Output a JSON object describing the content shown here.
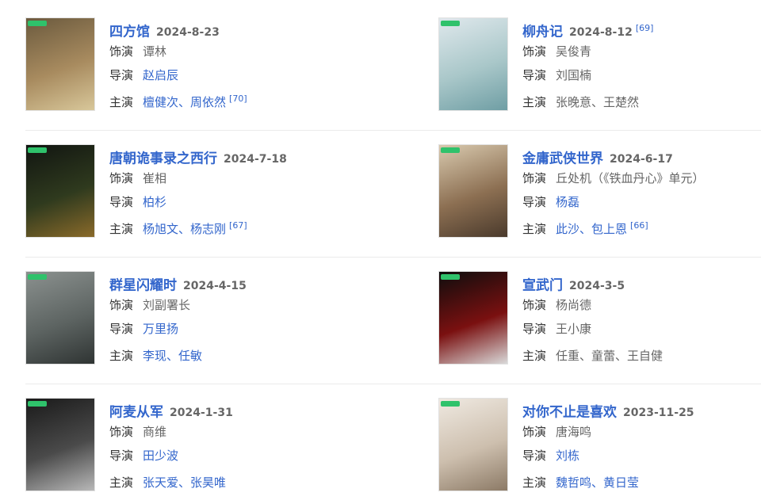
{
  "works": [
    {
      "title": "四方馆",
      "date": "2024-8-23",
      "ref": "",
      "role_label": "饰演",
      "role": "谭林",
      "director_label": "导演",
      "director": "赵启辰",
      "cast_label": "主演",
      "cast": "檀健次、周依然",
      "cast_ref": "[70]",
      "colors": [
        "#6b5a3e",
        "#a88b5f",
        "#d8c79a"
      ]
    },
    {
      "title": "柳舟记",
      "date": "2024-8-12",
      "ref": "[69]",
      "role_label": "饰演",
      "role": "吴俊青",
      "director_label": "导演",
      "director": "刘国楠",
      "cast_label": "主演",
      "cast": "张晚意、王楚然",
      "cast_ref": "",
      "colors": [
        "#dfe8ec",
        "#a9c7c9",
        "#6f9ea4"
      ]
    },
    {
      "title": "唐朝诡事录之西行",
      "date": "2024-7-18",
      "ref": "",
      "role_label": "饰演",
      "role": "崔相",
      "director_label": "导演",
      "director": "柏杉",
      "cast_label": "主演",
      "cast": "杨旭文、杨志刚",
      "cast_ref": "[67]",
      "colors": [
        "#111511",
        "#2f3a1e",
        "#8a6a2a"
      ]
    },
    {
      "title": "金庸武侠世界",
      "date": "2024-6-17",
      "ref": "",
      "role_label": "饰演",
      "role": "丘处机（《铁血丹心》单元）",
      "director_label": "导演",
      "director": "杨磊",
      "cast_label": "主演",
      "cast": "此沙、包上恩",
      "cast_ref": "[66]",
      "colors": [
        "#d8c9ae",
        "#8c6f52",
        "#4a3a2c"
      ]
    },
    {
      "title": "群星闪耀时",
      "date": "2024-4-15",
      "ref": "",
      "role_label": "饰演",
      "role": "刘副署长",
      "director_label": "导演",
      "director": "万里扬",
      "cast_label": "主演",
      "cast": "李现、任敏",
      "cast_ref": "",
      "colors": [
        "#8b918f",
        "#5d6462",
        "#2f3433"
      ]
    },
    {
      "title": "宣武门",
      "date": "2024-3-5",
      "ref": "",
      "role_label": "饰演",
      "role": "杨尚德",
      "director_label": "导演",
      "director": "王小康",
      "cast_label": "主演",
      "cast": "任重、童蕾、王自健",
      "cast_ref": "",
      "colors": [
        "#0d0d0d",
        "#7a1010",
        "#d9d9d9"
      ]
    },
    {
      "title": "阿麦从军",
      "date": "2024-1-31",
      "ref": "",
      "role_label": "饰演",
      "role": "商维",
      "director_label": "导演",
      "director": "田少波",
      "cast_label": "主演",
      "cast": "张天爱、张昊唯",
      "cast_ref": "",
      "colors": [
        "#1a1a1a",
        "#4a4a4a",
        "#b8b8b8"
      ]
    },
    {
      "title": "对你不止是喜欢",
      "date": "2023-11-25",
      "ref": "",
      "role_label": "饰演",
      "role": "唐海鸣",
      "director_label": "导演",
      "director": "刘栋",
      "cast_label": "主演",
      "cast": "魏哲鸣、黄日莹",
      "cast_ref": "",
      "colors": [
        "#efe9e1",
        "#cdbfae",
        "#8c7a66"
      ]
    }
  ],
  "links": {
    "role": [
      false,
      false,
      false,
      false,
      false,
      false,
      false,
      false
    ],
    "director": [
      true,
      false,
      true,
      true,
      true,
      false,
      true,
      true
    ],
    "cast": [
      true,
      false,
      true,
      true,
      true,
      false,
      true,
      true
    ]
  }
}
